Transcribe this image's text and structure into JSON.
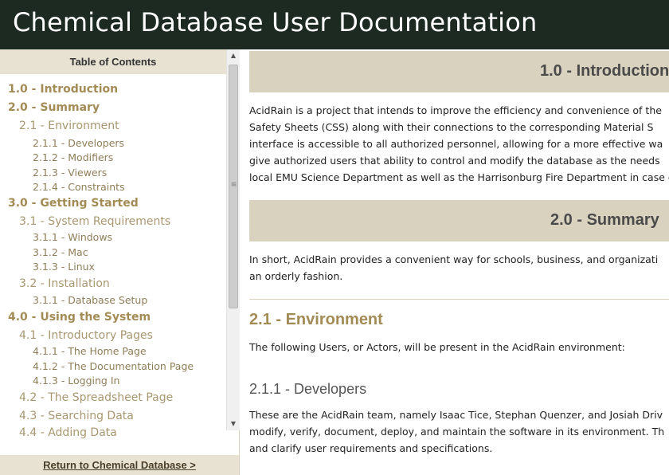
{
  "header": {
    "title": "Chemical Database User Documentation"
  },
  "sidebar": {
    "toc_title": "Table of Contents",
    "items": [
      {
        "label": "1.0 - Introduction",
        "level": 1
      },
      {
        "label": "2.0 - Summary",
        "level": 1
      },
      {
        "label": "2.1 - Environment",
        "level": 2
      },
      {
        "label": "2.1.1 - Developers",
        "level": 3
      },
      {
        "label": "2.1.2 - Modifiers",
        "level": 3
      },
      {
        "label": "2.1.3 - Viewers",
        "level": 3
      },
      {
        "label": "2.1.4 - Constraints",
        "level": 3
      },
      {
        "label": "3.0 - Getting Started",
        "level": 1
      },
      {
        "label": "3.1 - System Requirements",
        "level": 2
      },
      {
        "label": "3.1.1 - Windows",
        "level": 3
      },
      {
        "label": "3.1.2 - Mac",
        "level": 3
      },
      {
        "label": "3.1.3 - Linux",
        "level": 3
      },
      {
        "label": "3.2 - Installation",
        "level": 2
      },
      {
        "label": "3.1.1 - Database Setup",
        "level": 3
      },
      {
        "label": "4.0 - Using the System",
        "level": 1
      },
      {
        "label": "4.1 - Introductory Pages",
        "level": 2
      },
      {
        "label": "4.1.1 - The Home Page",
        "level": 3
      },
      {
        "label": "4.1.2 - The Documentation Page",
        "level": 3
      },
      {
        "label": "4.1.3 - Logging In",
        "level": 3
      },
      {
        "label": "4.2 - The Spreadsheet Page",
        "level": 2
      },
      {
        "label": "4.3 - Searching Data",
        "level": 2
      },
      {
        "label": "4.4 - Adding Data",
        "level": 2
      }
    ],
    "return_link": "Return to Chemical Database >",
    "scroll_up_icon": "triangle-up",
    "scroll_down_icon": "triangle-down"
  },
  "main": {
    "intro": {
      "title": "1.0 - Introduction",
      "lines": [
        "AcidRain is a project that intends to improve the efficiency and convenience of the",
        "Safety Sheets (CSS) along with their connections to the corresponding Material S",
        "interface is accessible to all authorized personnel, allowing for a more effective wa",
        "give authorized users that ability to control and modify the database as the needs",
        "local EMU Science Department as well as the Harrisonburg Fire Department in case o"
      ]
    },
    "summary": {
      "title": "2.0 - Summary",
      "lines": [
        "In short, AcidRain provides a convenient way for schools, business, and organizati",
        "an orderly fashion."
      ]
    },
    "environment": {
      "title": "2.1 - Environment",
      "text": "The following Users, or Actors, will be present in the AcidRain environment:"
    },
    "developers": {
      "title": "2.1.1 - Developers",
      "lines": [
        "These are the AcidRain team, namely Isaac Tice, Stephan Quenzer, and Josiah Driv",
        "modify, verify, document, deploy, and maintain the software in its environment. Th",
        "and clarify user requirements and specifications."
      ]
    }
  },
  "colors": {
    "header_bg": "#1c2a21",
    "band_bg": "#d9d2bf",
    "toc_title_bg": "#e8e2d3",
    "link_gold": "#a38b55"
  }
}
